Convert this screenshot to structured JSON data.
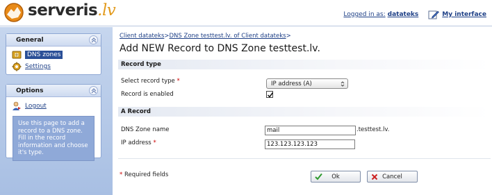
{
  "header": {
    "brand_main": "serveris",
    "brand_accent": ".lv",
    "logged_in_prefix": "Logged in as:",
    "username": "datateks",
    "my_interface": "My interface"
  },
  "sidebar": {
    "general": {
      "title": "General",
      "items": [
        {
          "label": "DNS zones",
          "icon": "dns-zones-icon",
          "selected": true
        },
        {
          "label": "Settings",
          "icon": "settings-gear-icon",
          "selected": false
        }
      ]
    },
    "options": {
      "title": "Options",
      "items": [
        {
          "label": "Logout",
          "icon": "logout-icon"
        }
      ],
      "help_text": "Use this page to add a record to a DNS zone. Fill in the record information and choose it's type."
    }
  },
  "main": {
    "breadcrumb": [
      {
        "label": "Client datateks"
      },
      {
        "label": "DNS Zone testtest.lv. of Client datateks"
      }
    ],
    "breadcrumb_sep": ">",
    "breadcrumb_trail": ">",
    "title": "Add NEW Record to DNS Zone testtest.lv.",
    "record_type_section": "Record type",
    "select_type_label": "Select record type",
    "select_type_value": "IP address (A)",
    "enabled_label": "Record is enabled",
    "enabled_checked": true,
    "a_record_section": "A Record",
    "zone_name_label": "DNS Zone name",
    "zone_name_value": "mail",
    "zone_suffix": ".testtest.lv.",
    "ip_label": "IP address",
    "ip_value": "123.123.123.123",
    "required_marker": "*",
    "required_note": "Required fields",
    "ok_label": "Ok",
    "cancel_label": "Cancel"
  },
  "colors": {
    "link": "#1d3f86",
    "sidebar_bg": "#b5c9e9",
    "help_bg": "#8fa9d8",
    "required": "#cc0000",
    "ok_check": "#2e9a2e",
    "cancel_x": "#cc1f1f"
  }
}
